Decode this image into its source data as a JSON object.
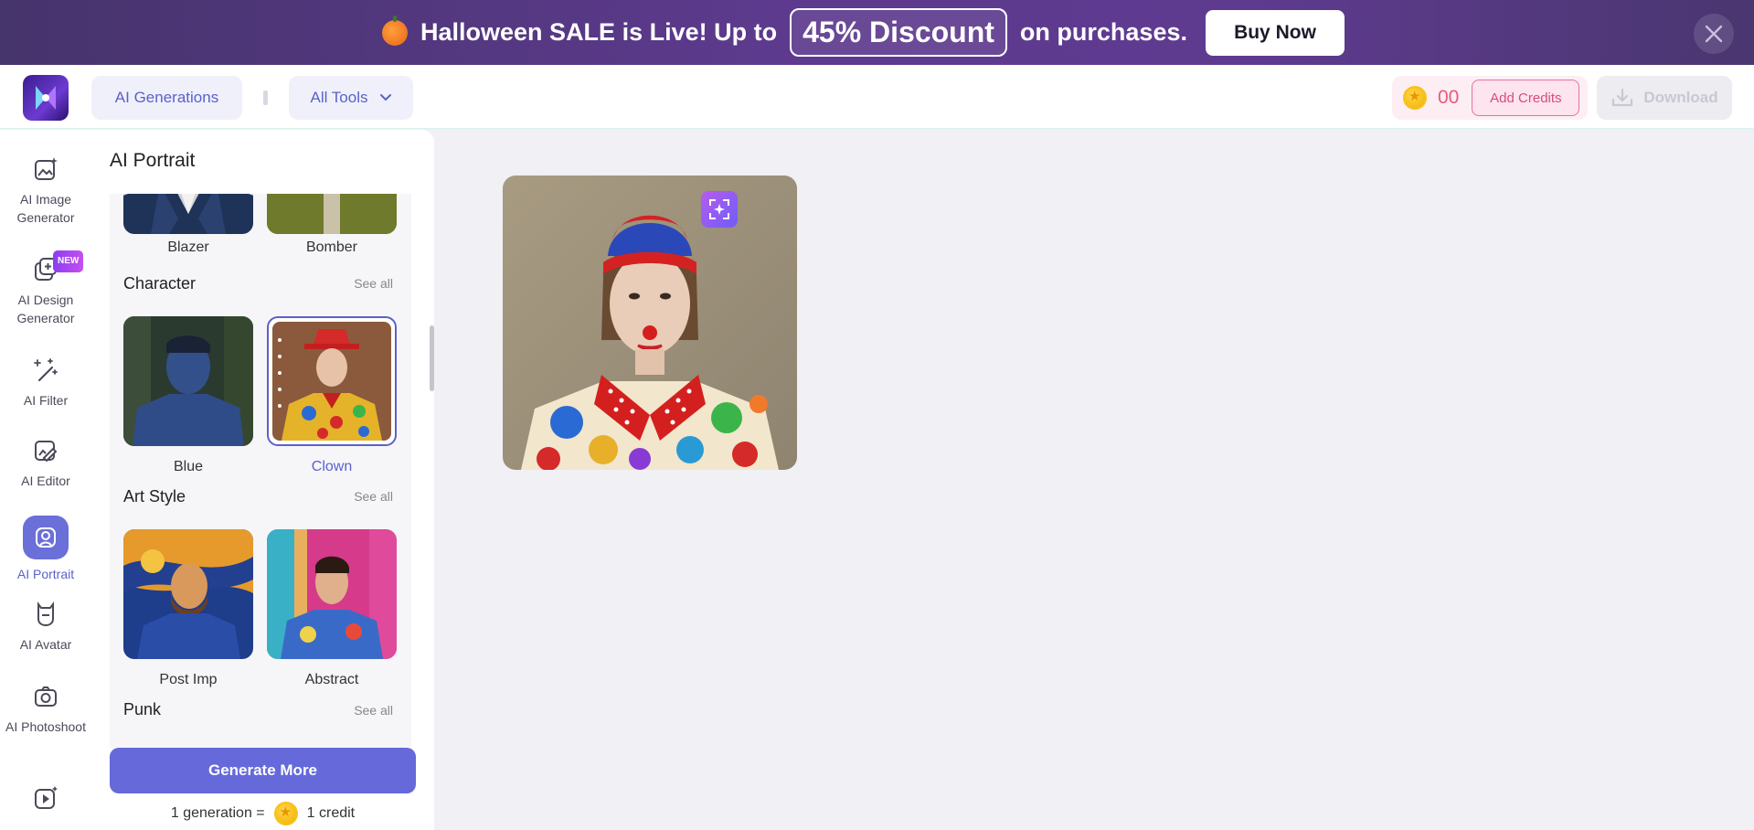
{
  "banner": {
    "text_before": "Halloween SALE is Live! Up to",
    "discount": "45% Discount",
    "text_after": "on purchases.",
    "buy_now": "Buy Now"
  },
  "header": {
    "ai_generations": "AI Generations",
    "all_tools": "All Tools",
    "credits": "00",
    "add_credits": "Add Credits",
    "download": "Download"
  },
  "nav": {
    "items": [
      {
        "label": "AI Image Generator",
        "icon": "image-sparkle-icon"
      },
      {
        "label": "AI Design Generator",
        "icon": "design-plus-icon",
        "badge": "NEW"
      },
      {
        "label": "AI Filter",
        "icon": "magic-wand-icon"
      },
      {
        "label": "AI Editor",
        "icon": "image-edit-icon"
      },
      {
        "label": "AI Portrait",
        "icon": "portrait-icon",
        "active": true
      },
      {
        "label": "AI Avatar",
        "icon": "avatar-icon"
      },
      {
        "label": "AI Photoshoot",
        "icon": "camera-sparkle-icon"
      },
      {
        "label": "",
        "icon": "video-sparkle-icon"
      }
    ]
  },
  "panel": {
    "title": "AI Portrait",
    "top_items": [
      {
        "label": "Blazer"
      },
      {
        "label": "Bomber"
      }
    ],
    "sections": [
      {
        "title": "Character",
        "see_all": "See all",
        "items": [
          {
            "label": "Blue"
          },
          {
            "label": "Clown",
            "selected": true
          }
        ]
      },
      {
        "title": "Art Style",
        "see_all": "See all",
        "items": [
          {
            "label": "Post Imp"
          },
          {
            "label": "Abstract"
          }
        ]
      },
      {
        "title": "Punk",
        "see_all": "See all",
        "items": []
      }
    ],
    "generate_more": "Generate More",
    "gen_note_left": "1 generation =",
    "gen_note_right": "1 credit"
  },
  "colors": {
    "accent": "#6569da",
    "banner": "#5d3a8e",
    "credit_pink": "#e75a7c"
  }
}
